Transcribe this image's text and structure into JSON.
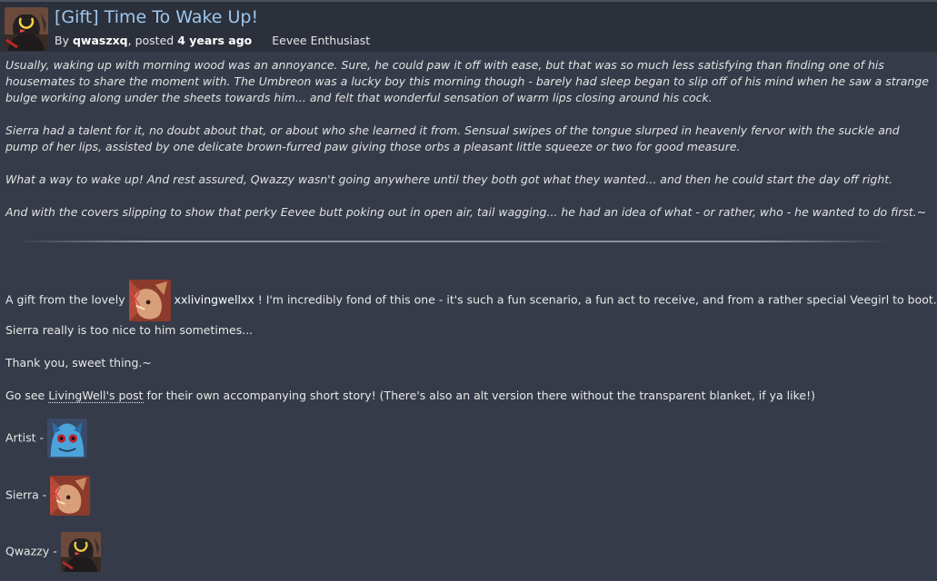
{
  "post": {
    "title": "[Gift] Time To Wake Up!",
    "by_label": "By",
    "author": "qwaszxq",
    "posted_label": ", posted",
    "posted_ago": "4 years ago",
    "user_rank": "Eevee Enthusiast"
  },
  "description": {
    "paragraphs": [
      "Usually, waking up with morning wood was an annoyance. Sure, he could paw it off with ease, but that was so much less satisfying than finding one of his housemates to share the moment with. The Umbreon was a lucky boy this morning though - barely had sleep began to slip off of his mind when he saw a strange bulge working along under the sheets towards him... and felt that wonderful sensation of warm lips closing around his cock.",
      "Sierra had a talent for it, no doubt about that, or about who she learned it from. Sensual swipes of the tongue slurped in heavenly fervor with the suckle and pump of her lips, assisted by one delicate brown-furred paw giving those orbs a pleasant little squeeze or two for good measure.",
      "What a way to wake up! And rest assured, Qwazzy wasn't going anywhere until they both got what they wanted... and then he could start the day off right.",
      "And with the covers slipping to show that perky Eevee butt poking out in open air, tail wagging... he had an idea of what - or rather, who - he wanted to do first.~"
    ]
  },
  "body": {
    "gift_prefix": "A gift from the lovely",
    "gift_user": "xxlivingwellxx",
    "gift_suffix": "! I'm incredibly fond of this one - it's such a fun scenario, a fun act to receive, and from a rather special Veegirl to boot.",
    "line2": "Sierra really is too nice to him sometimes...",
    "line3": "Thank you, sweet thing.~",
    "see_prefix": "Go see",
    "see_link": "LivingWell's post",
    "see_suffix": "for their own accompanying short story! (There's also an alt version there without the transparent blanket, if ya like!)",
    "artist_label": "Artist -",
    "sierra_label": "Sierra -",
    "qwazzy_label": "Qwazzy -"
  },
  "colors": {
    "background": "#353b48",
    "header_bg": "#2b303b",
    "title": "#9fc7ee"
  }
}
